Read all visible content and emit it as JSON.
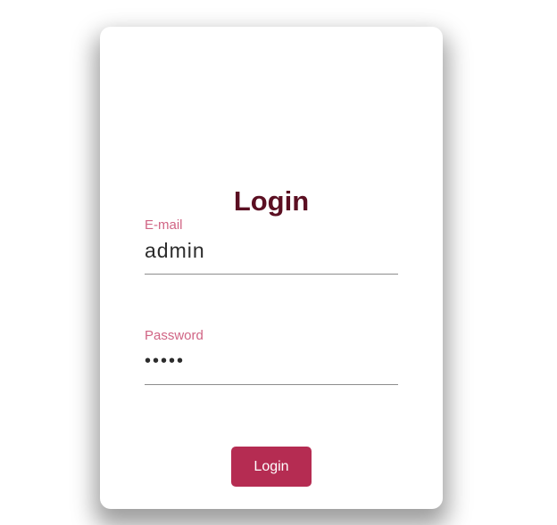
{
  "login": {
    "title": "Login",
    "email": {
      "label": "E-mail",
      "value": "admin"
    },
    "password": {
      "label": "Password",
      "value": "•••••"
    },
    "button_label": "Login"
  },
  "colors": {
    "title": "#5b0f22",
    "label": "#d06484",
    "button": "#b52c52",
    "underline": "#8d8d8d"
  }
}
